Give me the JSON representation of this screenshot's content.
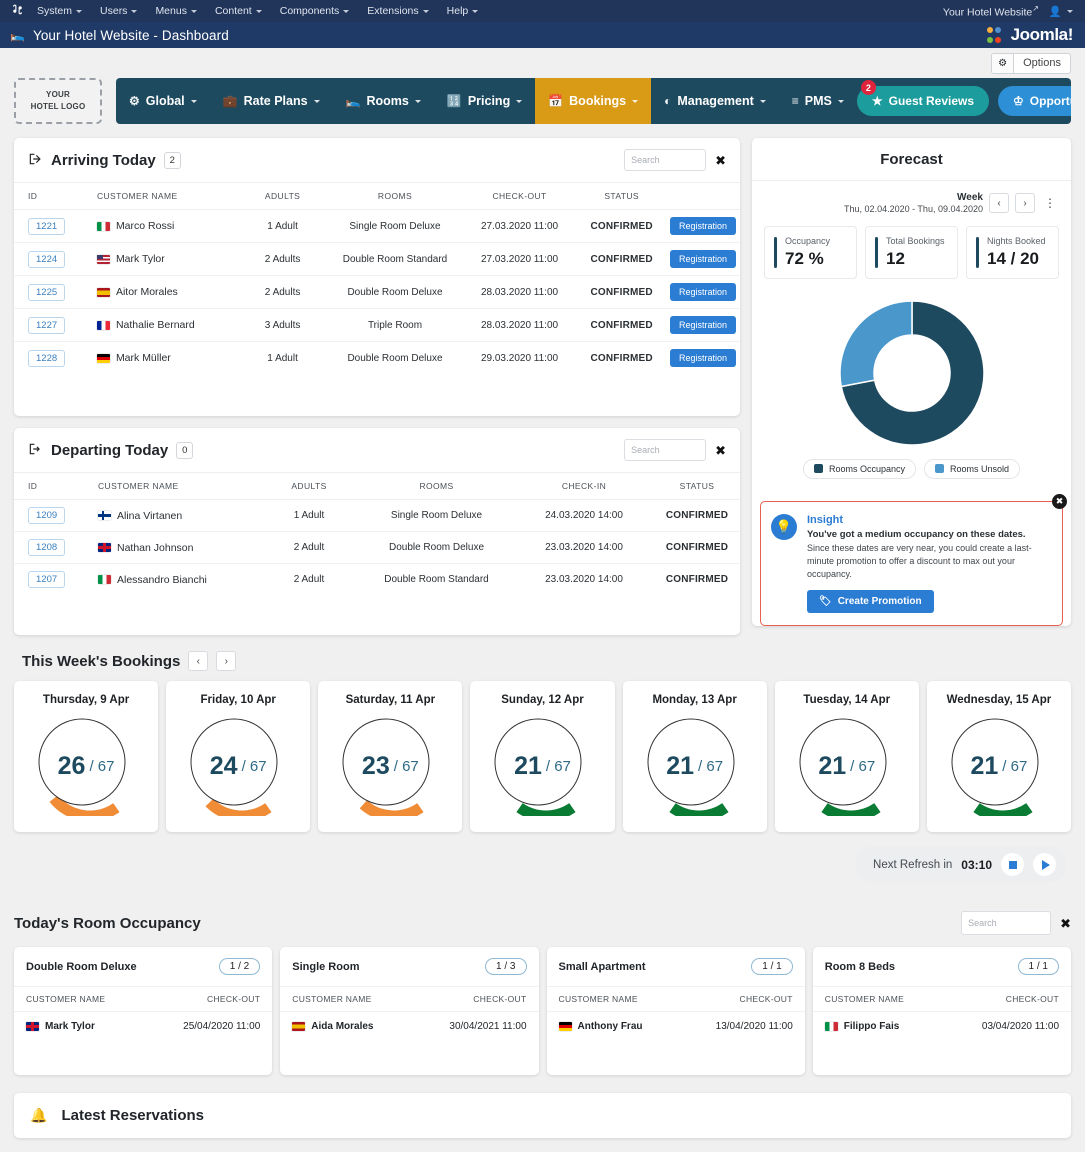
{
  "joomla": {
    "logo_icon": "joomla-logo-icon",
    "menu": [
      "System",
      "Users",
      "Menus",
      "Content",
      "Components",
      "Extensions",
      "Help"
    ],
    "site_link": "Your Hotel Website",
    "user_icon": "user-icon",
    "brand": "Joomla!",
    "title_icon": "bed-icon",
    "title": "Your Hotel Website - Dashboard",
    "options_label": "Options",
    "options_icon": "gear-icon"
  },
  "app_nav": {
    "logo_line1": "YOUR",
    "logo_line2": "HOTEL LOGO",
    "items": [
      {
        "label": "Global",
        "icon": "sliders-icon",
        "active": false
      },
      {
        "label": "Rate Plans",
        "icon": "briefcase-icon",
        "active": false
      },
      {
        "label": "Rooms",
        "icon": "bed-icon",
        "active": false
      },
      {
        "label": "Pricing",
        "icon": "calculator-icon",
        "active": false
      },
      {
        "label": "Bookings",
        "icon": "calendar-check-icon",
        "active": true
      },
      {
        "label": "Management",
        "icon": "pie-chart-icon",
        "active": false
      },
      {
        "label": "PMS",
        "icon": "list-icon",
        "active": false
      }
    ],
    "guest_reviews": {
      "label": "Guest Reviews",
      "icon": "star-icon",
      "badge": "2"
    },
    "opportunities": {
      "label": "Opportunities",
      "icon": "crown-icon"
    },
    "active_color": "#d99a16",
    "bar_color": "#1e4a5f"
  },
  "arriving": {
    "icon": "arrival-icon",
    "title": "Arriving Today",
    "count": "2",
    "search_placeholder": "Search",
    "clear_icon": "close-icon",
    "columns": [
      "ID",
      "CUSTOMER NAME",
      "ADULTS",
      "ROOMS",
      "CHECK-OUT",
      "STATUS"
    ],
    "action_label": "Registration",
    "rows": [
      {
        "id": "1221",
        "flag": "f-it",
        "name": "Marco Rossi",
        "adults": "1 Adult",
        "room": "Single Room Deluxe",
        "date": "27.03.2020 11:00",
        "status": "CONFIRMED"
      },
      {
        "id": "1224",
        "flag": "f-us",
        "name": "Mark Tylor",
        "adults": "2 Adults",
        "room": "Double Room Standard",
        "date": "27.03.2020 11:00",
        "status": "CONFIRMED"
      },
      {
        "id": "1225",
        "flag": "f-es",
        "name": "Aitor Morales",
        "adults": "2 Adults",
        "room": "Double Room Deluxe",
        "date": "28.03.2020 11:00",
        "status": "CONFIRMED"
      },
      {
        "id": "1227",
        "flag": "f-fr",
        "name": "Nathalie Bernard",
        "adults": "3 Adults",
        "room": "Triple Room",
        "date": "28.03.2020 11:00",
        "status": "CONFIRMED"
      },
      {
        "id": "1228",
        "flag": "f-de",
        "name": "Mark Müller",
        "adults": "1 Adult",
        "room": "Double Room Deluxe",
        "date": "29.03.2020 11:00",
        "status": "CONFIRMED"
      }
    ]
  },
  "departing": {
    "icon": "departure-icon",
    "title": "Departing Today",
    "count": "0",
    "search_placeholder": "Search",
    "clear_icon": "close-icon",
    "columns": [
      "ID",
      "CUSTOMER NAME",
      "ADULTS",
      "ROOMS",
      "CHECK-IN",
      "STATUS"
    ],
    "rows": [
      {
        "id": "1209",
        "flag": "f-fi",
        "name": "Alina Virtanen",
        "adults": "1 Adult",
        "room": "Single Room Deluxe",
        "date": "24.03.2020 14:00",
        "status": "CONFIRMED"
      },
      {
        "id": "1208",
        "flag": "f-gb",
        "name": "Nathan Johnson",
        "adults": "2 Adult",
        "room": "Double Room Deluxe",
        "date": "23.03.2020 14:00",
        "status": "CONFIRMED"
      },
      {
        "id": "1207",
        "flag": "f-it",
        "name": "Alessandro Bianchi",
        "adults": "2 Adult",
        "room": "Double Room Standard",
        "date": "23.03.2020 14:00",
        "status": "CONFIRMED"
      }
    ]
  },
  "forecast": {
    "title": "Forecast",
    "period_label": "Week",
    "period_range": "Thu, 02.04.2020 - Thu, 09.04.2020",
    "prev_icon": "chevron-left-icon",
    "next_icon": "chevron-right-icon",
    "menu_icon": "kebab-menu-icon",
    "metrics": [
      {
        "label": "Occupancy",
        "value": "72 %"
      },
      {
        "label": "Total Bookings",
        "value": "12"
      },
      {
        "label": "Nights Booked",
        "value": "14 / 20"
      }
    ],
    "insight": {
      "icon": "lightbulb-icon",
      "close_icon": "close-icon",
      "heading": "Insight",
      "bold_line": "You've got a medium occupancy on these dates.",
      "text": "Since these dates are very near, you could create a last-minute promotion to offer a discount to max out your occupancy.",
      "button_label": "Create Promotion",
      "button_icon": "tag-icon"
    }
  },
  "chart_data": {
    "type": "pie",
    "title": "Forecast",
    "labels": [
      "Rooms Occupancy",
      "Rooms Unsold"
    ],
    "values": [
      72,
      28
    ],
    "colors": [
      "#1e4a5f",
      "#4a97cb"
    ],
    "legend": "bottom",
    "donut": true
  },
  "week_bookings": {
    "title": "This Week's Bookings",
    "prev_icon": "chevron-left-icon",
    "next_icon": "chevron-right-icon",
    "total": "67",
    "days": [
      {
        "label": "Thursday, 9 Apr",
        "value": "26",
        "total": "67",
        "color": "#f08b36"
      },
      {
        "label": "Friday, 10 Apr",
        "value": "24",
        "total": "67",
        "color": "#f08b36"
      },
      {
        "label": "Saturday, 11 Apr",
        "value": "23",
        "total": "67",
        "color": "#f08b36"
      },
      {
        "label": "Sunday, 12 Apr",
        "value": "21",
        "total": "67",
        "color": "#0a7b32"
      },
      {
        "label": "Monday, 13 Apr",
        "value": "21",
        "total": "67",
        "color": "#0a7b32"
      },
      {
        "label": "Tuesday, 14 Apr",
        "value": "21",
        "total": "67",
        "color": "#0a7b32"
      },
      {
        "label": "Wednesday, 15 Apr",
        "value": "21",
        "total": "67",
        "color": "#0a7b32"
      }
    ]
  },
  "refresh": {
    "label": "Next Refresh in",
    "time": "03:10",
    "stop_icon": "stop-icon",
    "play_icon": "play-icon"
  },
  "occupancy": {
    "title": "Today's Room Occupancy",
    "search_placeholder": "Search",
    "clear_icon": "close-icon",
    "columns": [
      "CUSTOMER NAME",
      "CHECK-OUT"
    ],
    "cards": [
      {
        "name": "Double Room Deluxe",
        "chip": "1 / 2",
        "guest_flag": "f-gb",
        "guest": "Mark Tylor",
        "checkout": "25/04/2020 11:00"
      },
      {
        "name": "Single Room",
        "chip": "1 / 3",
        "guest_flag": "f-es",
        "guest": "Aida Morales",
        "checkout": "30/04/2021 11:00"
      },
      {
        "name": "Small Apartment",
        "chip": "1 / 1",
        "guest_flag": "f-de",
        "guest": "Anthony Frau",
        "checkout": "13/04/2020 11:00"
      },
      {
        "name": "Room 8 Beds",
        "chip": "1 / 1",
        "guest_flag": "f-it",
        "guest": "Filippo Fais",
        "checkout": "03/04/2020 11:00"
      }
    ]
  },
  "latest": {
    "icon": "bell-icon",
    "title": "Latest Reservations"
  }
}
